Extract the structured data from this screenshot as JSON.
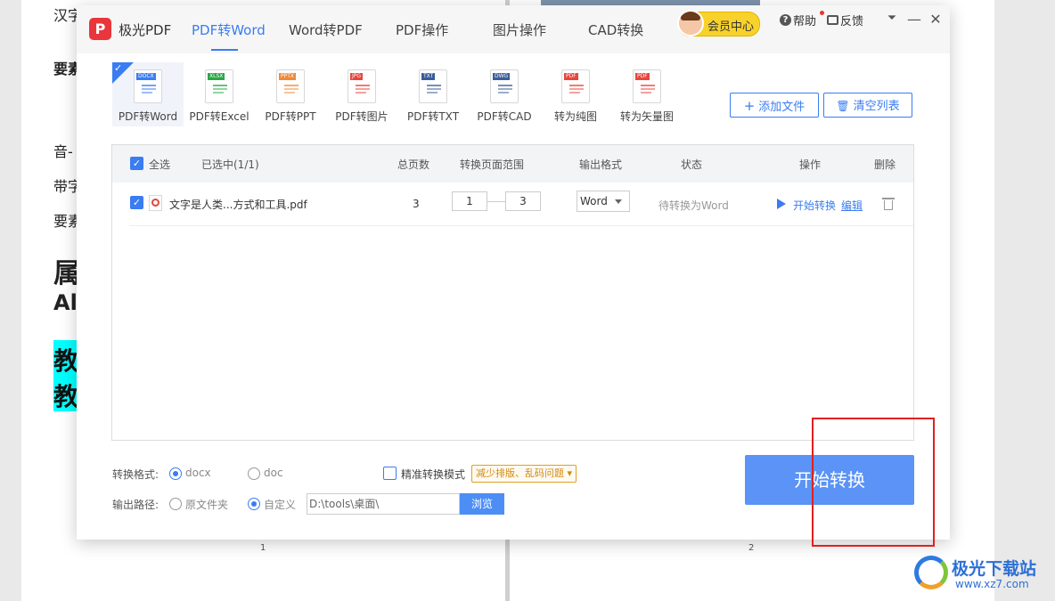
{
  "background_document": {
    "line1": "汉字",
    "line2": "要素",
    "line3": "音-",
    "line4": "带字",
    "line5": "要素",
    "heading1": "属",
    "heading2": "Al",
    "highlight1": "教",
    "highlight2": "教",
    "page_left": "1",
    "page_right": "2"
  },
  "titlebar": {
    "logo_letter": "P",
    "app_name": "极光PDF",
    "tabs": [
      "PDF转Word",
      "Word转PDF",
      "PDF操作",
      "图片操作",
      "CAD转换"
    ],
    "active_tab": "PDF转Word",
    "vip_label": "会员中心",
    "help_label": "帮助",
    "help_icon": "?",
    "feedback_label": "反馈",
    "menu_glyph": "⏷",
    "minimize_glyph": "—",
    "close_glyph": "✕"
  },
  "tools": [
    {
      "label": "PDF转Word",
      "tag": "DOCX",
      "color": "#3a7cf2",
      "active": true
    },
    {
      "label": "PDF转Excel",
      "tag": "XLSX",
      "color": "#28a745"
    },
    {
      "label": "PDF转PPT",
      "tag": "PPTX",
      "color": "#f08a3a"
    },
    {
      "label": "PDF转图片",
      "tag": "JPG",
      "color": "#e8453c"
    },
    {
      "label": "PDF转TXT",
      "tag": "TXT",
      "color": "#3a5d9a"
    },
    {
      "label": "PDF转CAD",
      "tag": "DWG",
      "color": "#3a5d9a"
    },
    {
      "label": "转为纯图",
      "tag": "PDF",
      "color": "#e8453c"
    },
    {
      "label": "转为矢量图",
      "tag": "PDF",
      "color": "#e8453c"
    }
  ],
  "actions": {
    "add_files": "添加文件",
    "clear_list": "清空列表"
  },
  "table": {
    "select_all": "全选",
    "selected_count": "已选中(1/1)",
    "headers": {
      "pages": "总页数",
      "range": "转换页面范围",
      "format": "输出格式",
      "status": "状态",
      "actions": "操作",
      "delete": "删除"
    },
    "rows": [
      {
        "filename": "文字是人类...方式和工具.pdf",
        "pages": "3",
        "range_from": "1",
        "range_to": "3",
        "format": "Word",
        "status": "待转换为Word",
        "start": "开始转换",
        "edit": "编辑"
      }
    ]
  },
  "options": {
    "format_label": "转换格式:",
    "format_docx": "docx",
    "format_doc": "doc",
    "precise_mode": "精准转换模式",
    "precise_tip": "减少排版、乱码问题",
    "output_label": "输出路径:",
    "output_original": "原文件夹",
    "output_custom": "自定义",
    "path_value": "D:\\tools\\桌面\\",
    "browse": "浏览",
    "start_button": "开始转换"
  },
  "watermark": {
    "title": "极光下载站",
    "url": "www.xz7.com"
  }
}
